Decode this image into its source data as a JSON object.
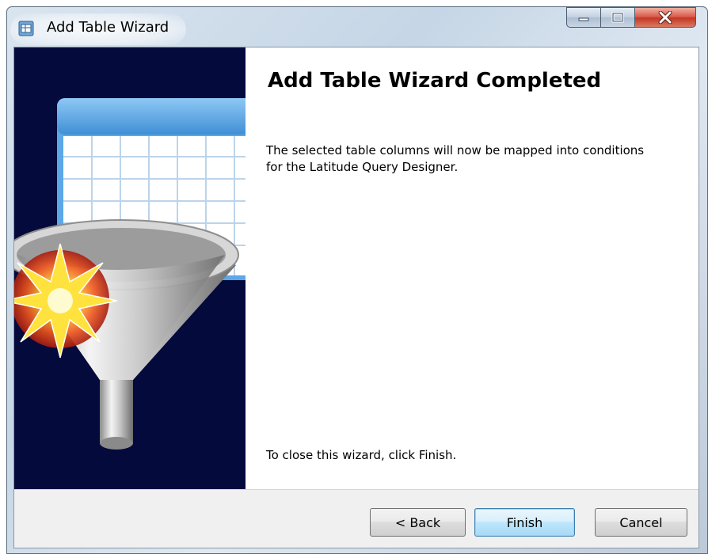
{
  "window": {
    "title": "Add Table Wizard",
    "controls": {
      "minimize": "minimize-icon",
      "maximize": "maximize-icon",
      "close": "close-icon"
    }
  },
  "banner": {
    "image": "funnel-table-illustration"
  },
  "page": {
    "heading": "Add Table Wizard Completed",
    "description": "The selected table columns will now be mapped into conditions for the Latitude Query Designer.",
    "close_hint": "To close this wizard, click Finish."
  },
  "buttons": {
    "back": "< Back",
    "finish": "Finish",
    "cancel": "Cancel"
  },
  "colors": {
    "banner_background": "#050a3d",
    "default_button_border": "#3c7fb1",
    "close_button": "#c43523"
  }
}
